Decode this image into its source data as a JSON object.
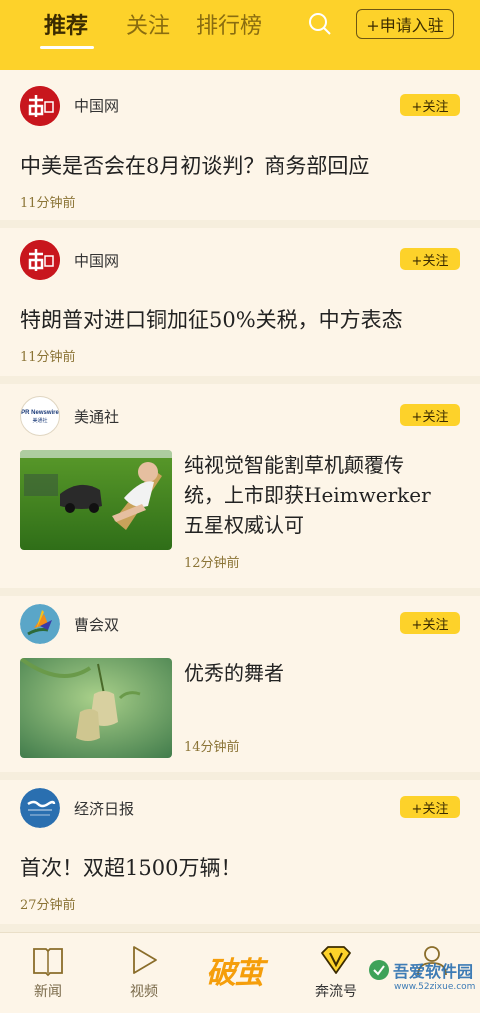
{
  "header": {
    "tabs": [
      {
        "label": "推荐",
        "active": true
      },
      {
        "label": "关注",
        "active": false
      },
      {
        "label": "排行榜",
        "active": false
      }
    ],
    "apply_label": "+申请入驻"
  },
  "feed": [
    {
      "source": "中国网",
      "follow": "+关注",
      "title": "中美是否会在8月初谈判？商务部回应",
      "time": "11分钟前"
    },
    {
      "source": "中国网",
      "follow": "+关注",
      "title": "特朗普对进口铜加征50%关税，中方表态",
      "time": "11分钟前"
    },
    {
      "source": "美通社",
      "follow": "+关注",
      "title_lines": [
        "纯视觉智能割草机颠覆传",
        "统，上市即获Heimwerker",
        "五星权威认可"
      ],
      "time": "12分钟前",
      "avatar_text_1": "PR Newswire",
      "avatar_text_2": "美通社"
    },
    {
      "source": "曹会双",
      "follow": "+关注",
      "title": "优秀的舞者",
      "time": "14分钟前"
    },
    {
      "source": "经济日报",
      "follow": "+关注",
      "title": "首次！双超1500万辆！",
      "time": "27分钟前"
    }
  ],
  "nav": [
    {
      "label": "新闻",
      "icon": "book-icon"
    },
    {
      "label": "视频",
      "icon": "play-icon"
    },
    {
      "label": "奔流号",
      "icon": "badge-v-icon"
    },
    {
      "label": "",
      "icon": "user-icon"
    }
  ],
  "brand": "破茧",
  "watermark": {
    "line1": "吾爱软件园",
    "line2": "www.52zixue.com"
  },
  "colors": {
    "accent": "#fdd22a",
    "background": "#fdf5e8",
    "time": "#8b7436"
  }
}
